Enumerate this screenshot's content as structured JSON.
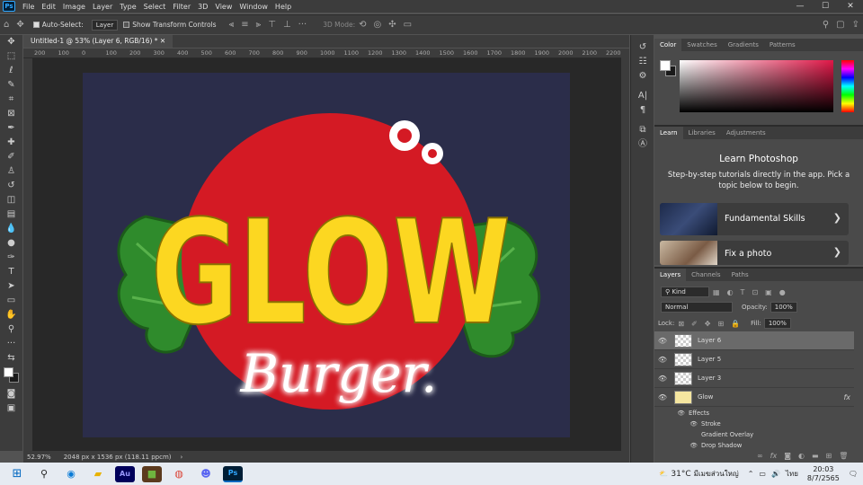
{
  "app": {
    "logo": "Ps"
  },
  "menu": [
    "File",
    "Edit",
    "Image",
    "Layer",
    "Type",
    "Select",
    "Filter",
    "3D",
    "View",
    "Window",
    "Help"
  ],
  "window_controls": [
    "—",
    "☐",
    "✕"
  ],
  "options_bar": {
    "auto_select_label": "Auto-Select:",
    "auto_select_value": "Layer",
    "show_transform_label": "Show Transform Controls",
    "mode_3d_label": "3D Mode:"
  },
  "document_tab": "Untitled-1 @ 53% (Layer 6, RGB/16) *",
  "ruler_ticks": [
    "200",
    "100",
    "0",
    "100",
    "200",
    "300",
    "400",
    "500",
    "600",
    "700",
    "800",
    "900",
    "1000",
    "1100",
    "1200",
    "1300",
    "1400",
    "1500",
    "1600",
    "1700",
    "1800",
    "1900",
    "2000",
    "2100",
    "2200"
  ],
  "artwork": {
    "title": "GLOW",
    "subtitle": "Burger."
  },
  "status": {
    "zoom": "52.97%",
    "doc_size": "2048 px x 1536 px (118.11 ppcm)",
    "arrow": "›"
  },
  "color_panel": {
    "tabs": [
      "Color",
      "Swatches",
      "Gradients",
      "Patterns"
    ],
    "active": "Color",
    "fg": "#ffffff",
    "bg": "#1a1a1a"
  },
  "learn_panel": {
    "tabs": [
      "Learn",
      "Libraries",
      "Adjustments"
    ],
    "active": "Learn",
    "title": "Learn Photoshop",
    "description": "Step-by-step tutorials directly in the app. Pick a topic below to begin.",
    "cards": [
      {
        "label": "Fundamental Skills"
      },
      {
        "label": "Fix a photo"
      }
    ]
  },
  "layers_panel": {
    "tabs": [
      "Layers",
      "Channels",
      "Paths"
    ],
    "active": "Layers",
    "filter_label": "Kind",
    "blend_mode": "Normal",
    "opacity_label": "Opacity:",
    "opacity": "100%",
    "lock_label": "Lock:",
    "fill_label": "Fill:",
    "fill": "100%",
    "layers": [
      {
        "name": "Layer 6",
        "selected": true
      },
      {
        "name": "Layer 5",
        "selected": false
      },
      {
        "name": "Layer 3",
        "selected": false
      },
      {
        "name": "Glow",
        "selected": false,
        "fx": "fx"
      }
    ],
    "effects_label": "Effects",
    "effects": [
      "Stroke",
      "Gradient Overlay",
      "Drop Shadow"
    ]
  },
  "taskbar": {
    "weather": "31°C",
    "weather_desc": "มีเมฆส่วนใหญ่",
    "lang": "ไทย",
    "time": "20:03",
    "date": "8/7/2565"
  }
}
